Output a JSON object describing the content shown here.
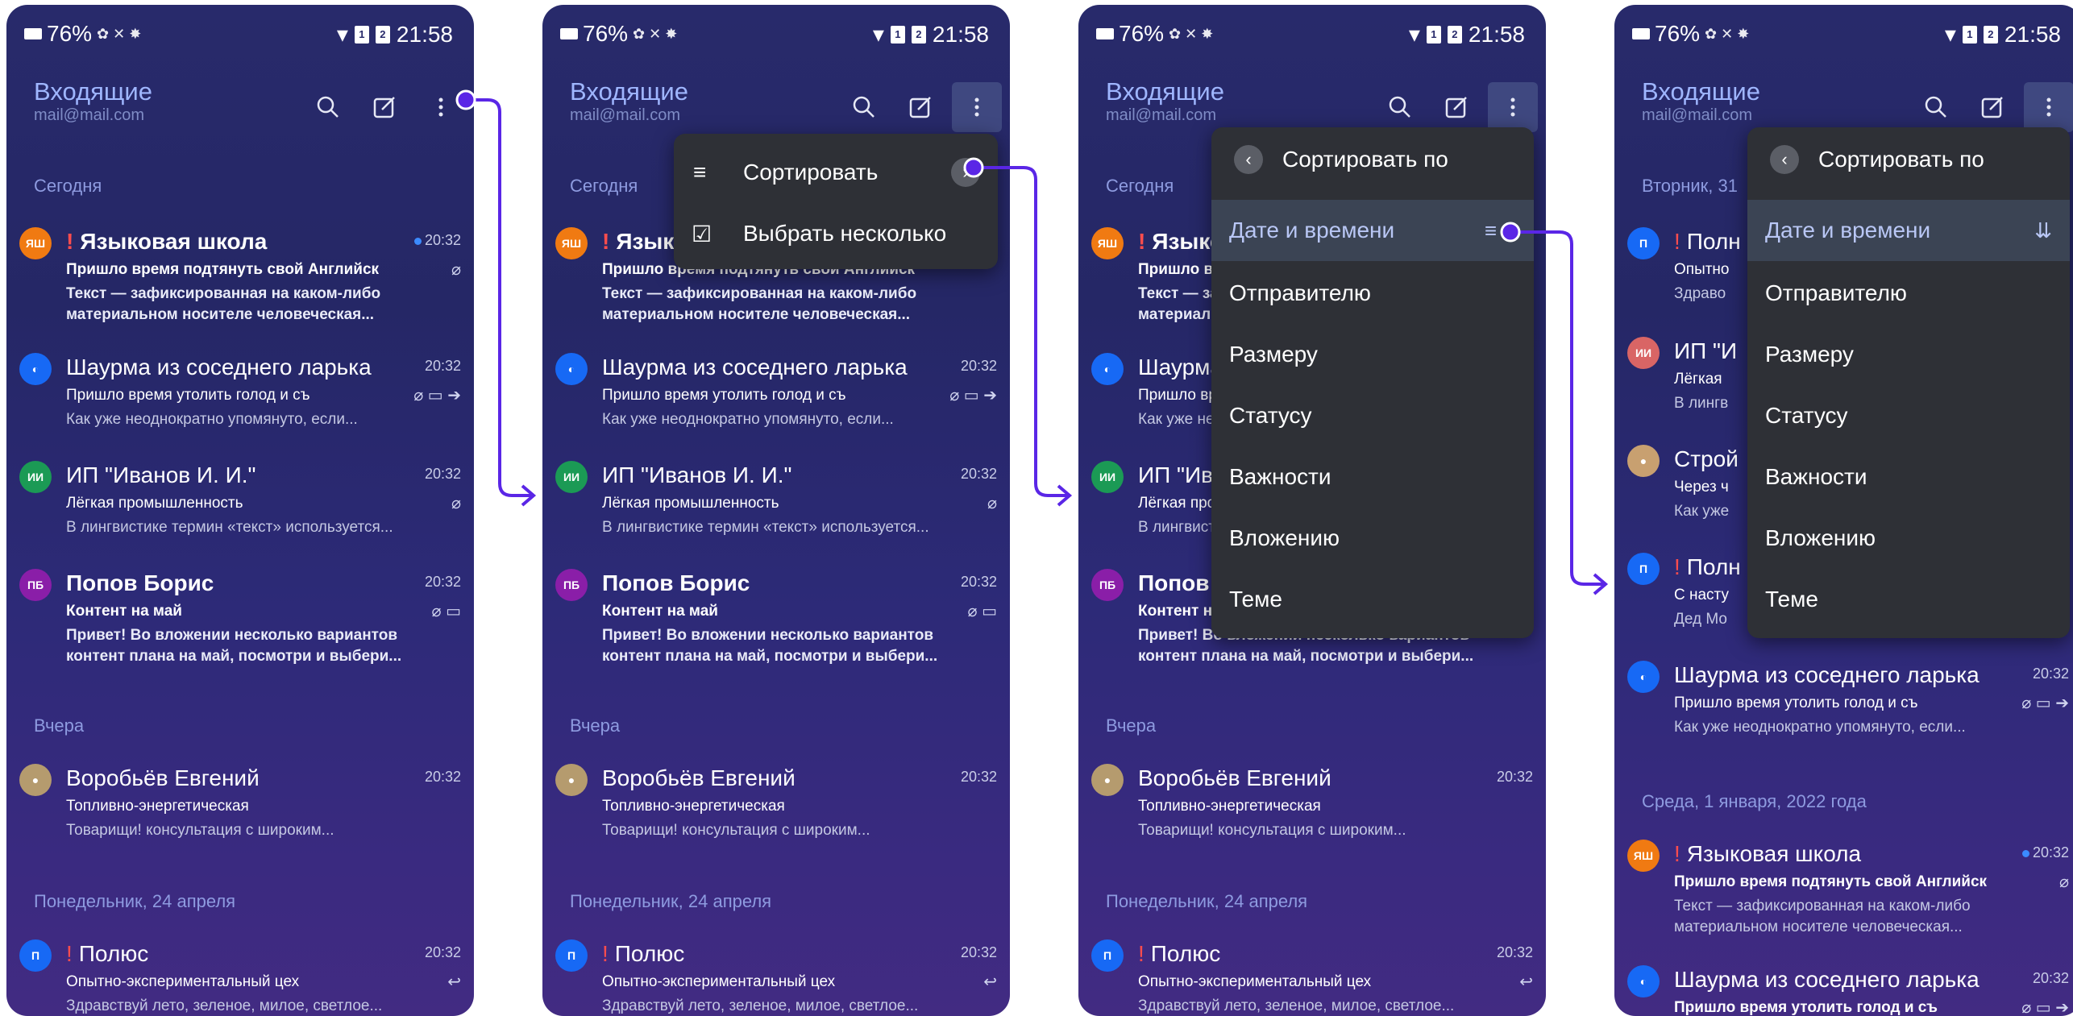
{
  "status": {
    "battery": "76%",
    "time": "21:58",
    "sim1": "1",
    "sim2": "2"
  },
  "header": {
    "title": "Входящие",
    "account": "mail@mail.com"
  },
  "sections": {
    "today": "Сегодня",
    "yesterday": "Вчера",
    "monday": "Понедельник, 24 апреля",
    "tuesday": "Вторник, 31",
    "wednesday": "Среда, 1 января, 2022 года"
  },
  "emails": {
    "school": {
      "avatar": "ЯШ",
      "sender": "Языковая школа",
      "time": "20:32",
      "subject": "Пришло время подтянуть свой Английск",
      "preview": "Текст — зафиксированная на каком-либо материальном носителе человеческая..."
    },
    "shaurma": {
      "sender": "Шаурма из соседнего ларька",
      "time": "20:32",
      "subject": "Пришло время утолить голод и съ",
      "preview": "Как уже неоднократно упомянуто, если..."
    },
    "ivanov": {
      "avatar": "ИИ",
      "sender": "ИП \"Иванов И. И.\"",
      "time": "20:32",
      "subject": "Лёгкая промышленность",
      "preview": "В лингвистике термин «текст» используется..."
    },
    "popov": {
      "avatar": "ПБ",
      "sender": "Попов Борис",
      "time": "20:32",
      "subject": "Контент на май",
      "preview": "Привет! Во вложении несколько вариантов контент плана на май, посмотри и выбери..."
    },
    "vorobev": {
      "sender": "Воробьёв Евгений",
      "time": "20:32",
      "subject": "Топливно-энергетическая",
      "preview": "Товарищи! консультация с широким..."
    },
    "polyus": {
      "avatar": "П",
      "sender": "Полюс",
      "time": "20:32",
      "subject": "Опытно-экспериментальный цех",
      "preview": "Здравствуй лето, зеленое, милое, светлое..."
    },
    "polyus4a": {
      "sender": "Полн",
      "subject": "Опытно",
      "preview": "Здраво"
    },
    "ivanov4": {
      "sender": "ИП \"И",
      "subject": "Лёгкая",
      "preview": "В лингв"
    },
    "stroy4": {
      "sender": "Строй",
      "subject": "Через ч",
      "preview": "Как уже"
    },
    "polyus4b": {
      "sender": "Полн",
      "subject": "С насту",
      "preview": "Дед Мо"
    },
    "shaurma4b": {
      "subject": "Пришло время утолить голод и съ"
    }
  },
  "menu1": {
    "items": [
      {
        "label": "Сортировать"
      },
      {
        "label": "Выбрать несколько"
      }
    ]
  },
  "sort_menu": {
    "title": "Сортировать по",
    "items": [
      {
        "label": "Дате и времени"
      },
      {
        "label": "Отправителю"
      },
      {
        "label": "Размеру"
      },
      {
        "label": "Статусу"
      },
      {
        "label": "Важности"
      },
      {
        "label": "Вложению"
      },
      {
        "label": "Теме"
      }
    ]
  },
  "colors": {
    "accent": "#5a26e6",
    "school": "#f07a12",
    "ivanov": "#1b9a55",
    "popov": "#8a1ea8",
    "polyus": "#1769f5",
    "ivanov4": "#d96565"
  }
}
